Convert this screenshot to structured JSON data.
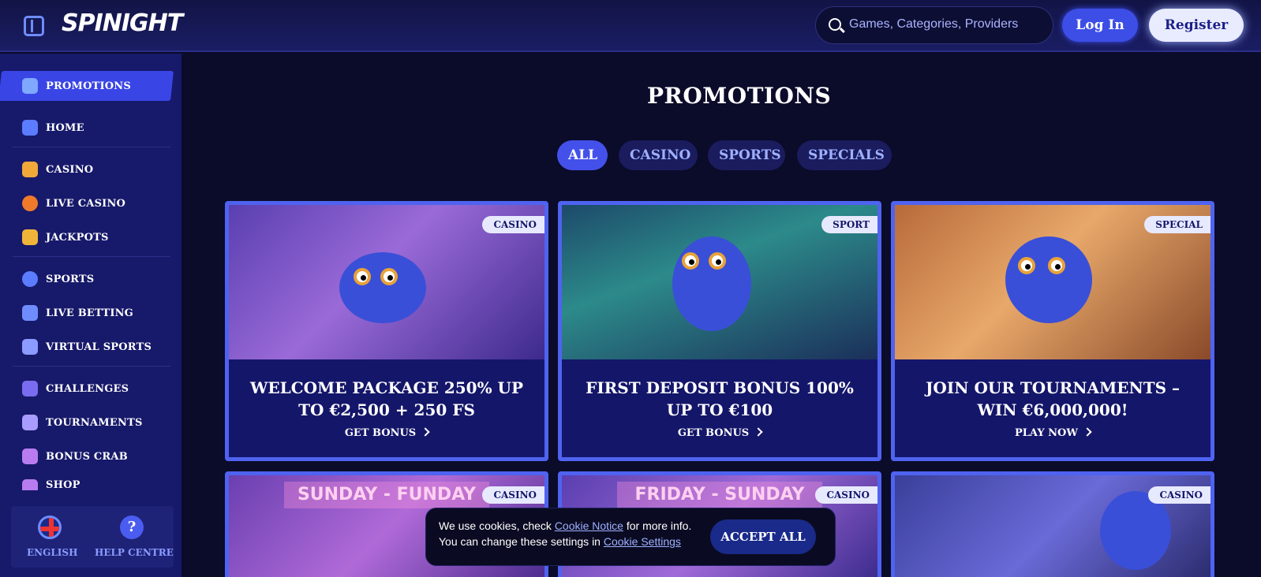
{
  "header": {
    "logo": "SPINIGHT",
    "search_placeholder": "Games, Categories, Providers",
    "login": "Log In",
    "register": "Register"
  },
  "sidebar": {
    "items": [
      {
        "label": "PROMOTIONS",
        "icon": "gift-icon",
        "active": true
      },
      {
        "label": "HOME",
        "icon": "home-icon"
      },
      {
        "label": "CASINO",
        "icon": "casino-icon"
      },
      {
        "label": "LIVE CASINO",
        "icon": "live-casino-icon"
      },
      {
        "label": "JACKPOTS",
        "icon": "jackpot-icon"
      },
      {
        "label": "SPORTS",
        "icon": "sports-ball-icon"
      },
      {
        "label": "LIVE BETTING",
        "icon": "live-betting-icon"
      },
      {
        "label": "VIRTUAL SPORTS",
        "icon": "virtual-sports-icon"
      },
      {
        "label": "CHALLENGES",
        "icon": "challenge-star-icon"
      },
      {
        "label": "TOURNAMENTS",
        "icon": "trophy-icon"
      },
      {
        "label": "BONUS CRAB",
        "icon": "bonus-crab-icon"
      },
      {
        "label": "SHOP",
        "icon": "shop-icon"
      }
    ],
    "language": "ENGLISH",
    "help": "HELP CENTRE"
  },
  "main": {
    "title": "PROMOTIONS",
    "filters": [
      "ALL",
      "CASINO",
      "SPORTS",
      "SPECIALS"
    ],
    "active_filter": "ALL",
    "cards": [
      {
        "tag": "CASINO",
        "title": "WELCOME PACKAGE 250% UP TO €2,500 + 250 FS",
        "cta": "GET BONUS"
      },
      {
        "tag": "SPORT",
        "title": "FIRST DEPOSIT BONUS 100% UP TO €100",
        "cta": "GET BONUS"
      },
      {
        "tag": "SPECIAL",
        "title": "JOIN OUR TOURNAMENTS – WIN €6,000,000!",
        "cta": "PLAY NOW"
      },
      {
        "tag": "CASINO",
        "banner": "SUNDAY - FUNDAY"
      },
      {
        "tag": "CASINO",
        "banner": "FRIDAY - SUNDAY"
      },
      {
        "tag": "CASINO"
      }
    ]
  },
  "cookie": {
    "line1_pre": "We use cookies, check ",
    "line1_link": "Cookie Notice",
    "line1_post": " for more info.",
    "line2_pre": "You can change these settings in ",
    "line2_link": "Cookie Settings",
    "accept": "ACCEPT ALL"
  },
  "colors": {
    "accent": "#4351ea",
    "sidebar": "#17196a",
    "background": "#0b0b2a"
  }
}
